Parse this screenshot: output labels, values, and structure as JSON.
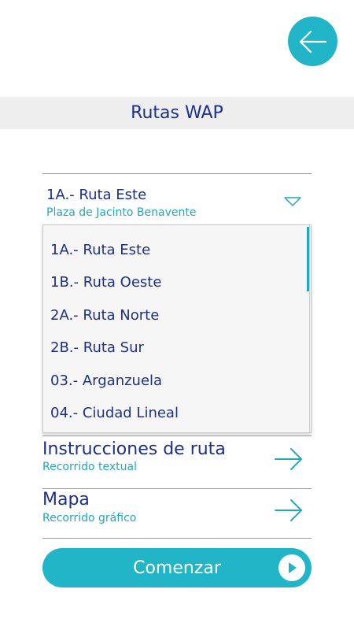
{
  "header": {
    "title": "Rutas WAP",
    "back_icon": "arrow-left-icon"
  },
  "route_selector": {
    "selected_title": "1A.- Ruta Este",
    "selected_subtitle": "Plaza de Jacinto Benavente",
    "toggle_icon": "triangle-down-icon"
  },
  "dropdown": {
    "options": [
      "1A.- Ruta Este",
      "1B.- Ruta Oeste",
      "2A.- Ruta Norte",
      "2B.- Ruta Sur",
      "03.- Arganzuela",
      "04.- Ciudad Lineal"
    ]
  },
  "menu": {
    "instructions": {
      "title": "Instrucciones de ruta",
      "subtitle": "Recorrido textual",
      "icon": "arrow-right-icon"
    },
    "map": {
      "title": "Mapa",
      "subtitle": "Recorrido gráfico",
      "icon": "arrow-right-icon"
    }
  },
  "start_button": {
    "label": "Comenzar",
    "icon": "play-icon"
  },
  "colors": {
    "accent": "#22b5c8",
    "text_primary": "#1d2f8c",
    "text_secondary": "#22a6c1"
  }
}
